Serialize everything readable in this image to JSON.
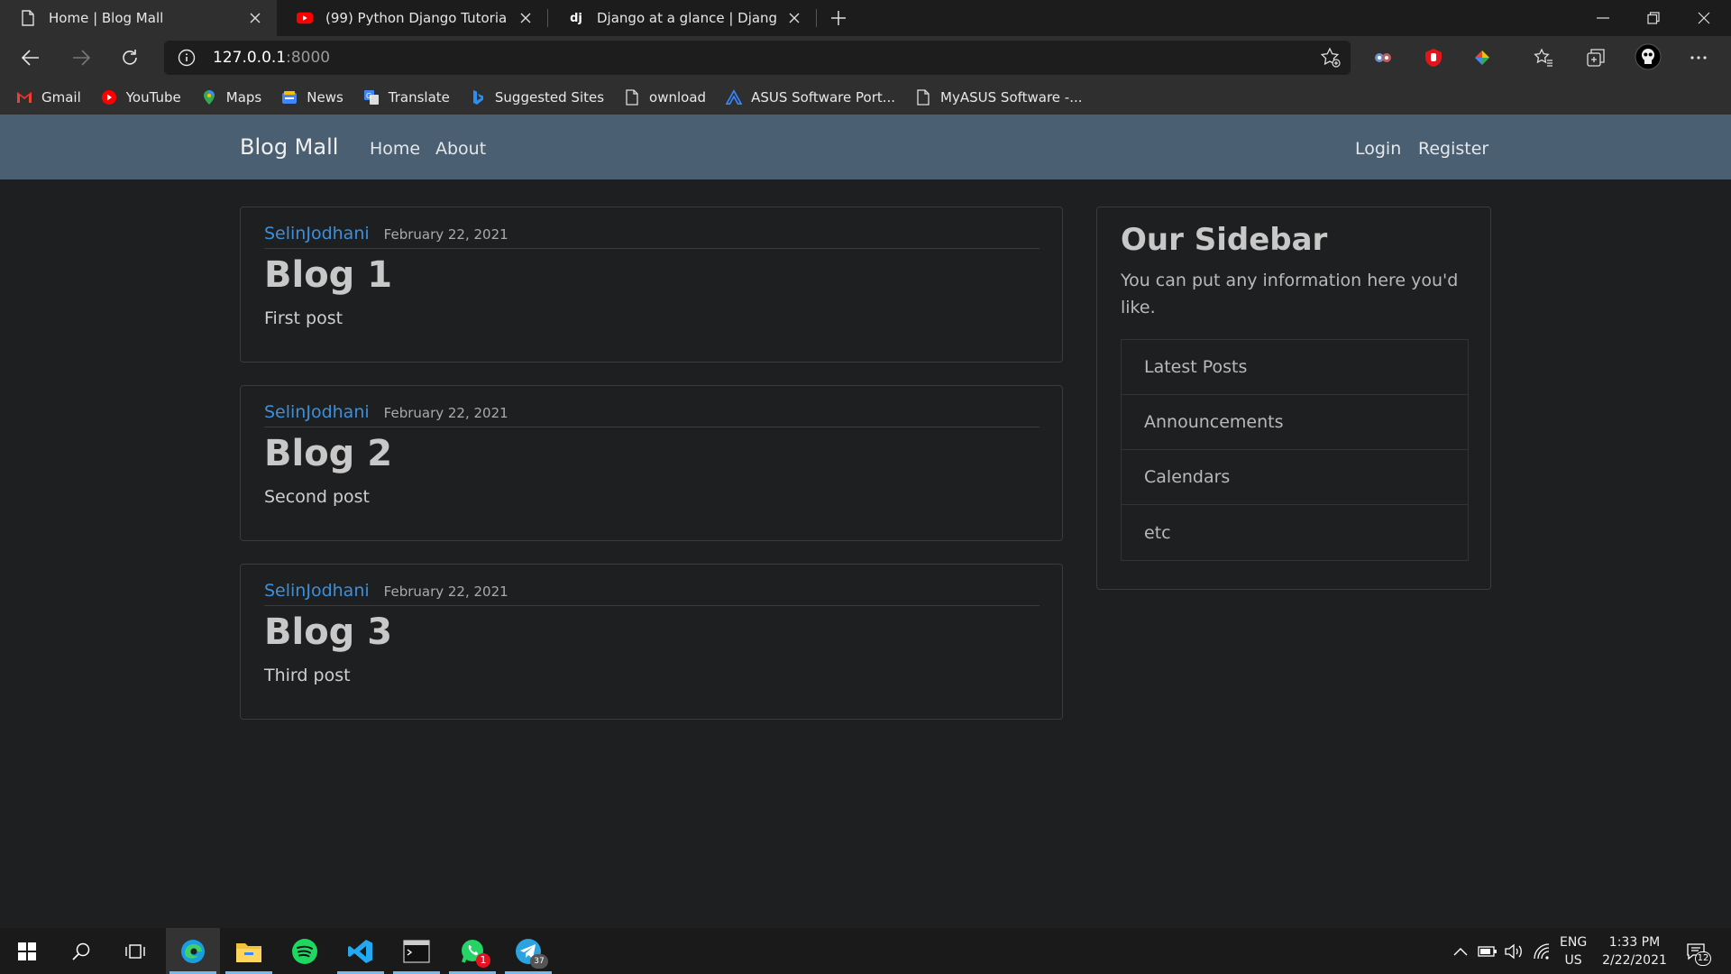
{
  "browser": {
    "tabs": [
      {
        "title": "Home | Blog Mall",
        "active": true
      },
      {
        "title": "(99) Python Django Tutorial: Full",
        "active": false
      },
      {
        "title": "Django at a glance | Django doc",
        "active": false
      }
    ],
    "url_host": "127.0.0.1",
    "url_port": ":8000",
    "bookmarks": [
      {
        "label": "Gmail",
        "icon": "gmail-icon"
      },
      {
        "label": "YouTube",
        "icon": "youtube-icon"
      },
      {
        "label": "Maps",
        "icon": "maps-icon"
      },
      {
        "label": "News",
        "icon": "news-icon"
      },
      {
        "label": "Translate",
        "icon": "translate-icon"
      },
      {
        "label": "Suggested Sites",
        "icon": "bing-icon"
      },
      {
        "label": "ownload",
        "icon": "page-icon"
      },
      {
        "label": "ASUS Software Port...",
        "icon": "asus-icon"
      },
      {
        "label": "MyASUS Software -...",
        "icon": "page-icon"
      }
    ]
  },
  "site": {
    "brand": "Blog Mall",
    "nav_left": [
      "Home",
      "About"
    ],
    "nav_right": [
      "Login",
      "Register"
    ],
    "posts": [
      {
        "author": "SelinJodhani",
        "date": "February 22, 2021",
        "title": "Blog 1",
        "body": "First post"
      },
      {
        "author": "SelinJodhani",
        "date": "February 22, 2021",
        "title": "Blog 2",
        "body": "Second post"
      },
      {
        "author": "SelinJodhani",
        "date": "February 22, 2021",
        "title": "Blog 3",
        "body": "Third post"
      }
    ],
    "sidebar": {
      "title": "Our Sidebar",
      "text": "You can put any information here you'd like.",
      "items": [
        "Latest Posts",
        "Announcements",
        "Calendars",
        "etc"
      ]
    }
  },
  "taskbar": {
    "lang_1": "ENG",
    "lang_2": "US",
    "time": "1:33 PM",
    "date": "2/22/2021",
    "whatsapp_badge": "1",
    "telegram_badge": "37",
    "notification_count": "12"
  },
  "colors": {
    "navbar": "#4b5f73",
    "page_bg": "#1e1f20",
    "author_link": "#3f8fd8"
  }
}
